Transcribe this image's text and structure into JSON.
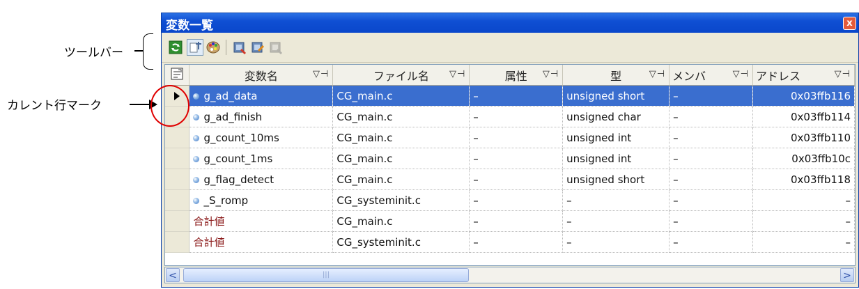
{
  "annotations": {
    "toolbar_label": "ツールバー",
    "current_row_label": "カレント行マーク"
  },
  "window": {
    "title": "変数一覧",
    "close_label": "x"
  },
  "toolbar": {
    "buttons": [
      "refresh-icon",
      "pin-icon",
      "palette-icon",
      "variable-add-icon",
      "variable-edit-icon",
      "variable-delete-icon"
    ]
  },
  "grid": {
    "columns": [
      {
        "label": "変数名",
        "filter": "▽⊣"
      },
      {
        "label": "ファイル名",
        "filter": "▽⊣"
      },
      {
        "label": "属性",
        "filter": "▽⊣"
      },
      {
        "label": "型",
        "filter": "▽⊣"
      },
      {
        "label": "メンバ",
        "filter": "▽⊣"
      },
      {
        "label": "アドレス",
        "filter": "▽⊣"
      }
    ],
    "rows": [
      {
        "name": "g_ad_data",
        "file": "CG_main.c",
        "attr": "–",
        "type": "unsigned short",
        "member": "–",
        "address": "0x03ffb116",
        "icon": true,
        "current": true
      },
      {
        "name": "g_ad_finish",
        "file": "CG_main.c",
        "attr": "–",
        "type": "unsigned char",
        "member": "–",
        "address": "0x03ffb114",
        "icon": true
      },
      {
        "name": "g_count_10ms",
        "file": "CG_main.c",
        "attr": "–",
        "type": "unsigned int",
        "member": "–",
        "address": "0x03ffb110",
        "icon": true
      },
      {
        "name": "g_count_1ms",
        "file": "CG_main.c",
        "attr": "–",
        "type": "unsigned int",
        "member": "–",
        "address": "0x03ffb10c",
        "icon": true
      },
      {
        "name": "g_flag_detect",
        "file": "CG_main.c",
        "attr": "–",
        "type": "unsigned short",
        "member": "–",
        "address": "0x03ffb118",
        "icon": true
      },
      {
        "name": "_S_romp",
        "file": "CG_systeminit.c",
        "attr": "–",
        "type": "–",
        "member": "–",
        "address": "–",
        "icon": true
      },
      {
        "name": "合計値",
        "file": "CG_main.c",
        "attr": "–",
        "type": "–",
        "member": "–",
        "address": "–",
        "icon": false,
        "sum": true
      },
      {
        "name": "合計値",
        "file": "CG_systeminit.c",
        "attr": "–",
        "type": "–",
        "member": "–",
        "address": "–",
        "icon": false,
        "sum": true
      }
    ]
  },
  "scrollbar": {
    "left_arrow": "<",
    "right_arrow": ">",
    "thumb_grip": "|||"
  }
}
